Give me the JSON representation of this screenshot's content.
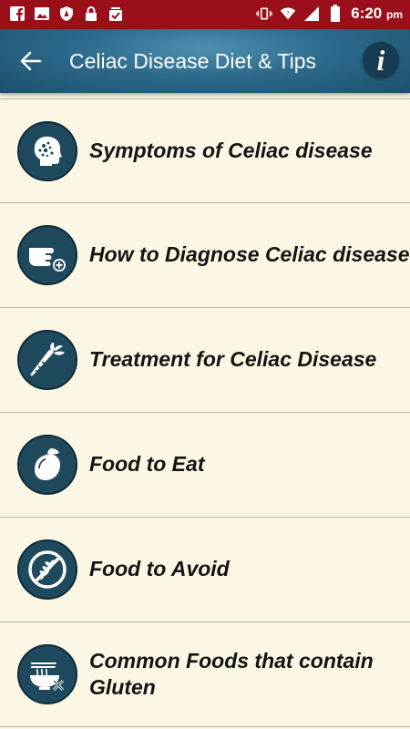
{
  "status_bar": {
    "time": "6:20",
    "ampm": "pm"
  },
  "app_bar": {
    "title": "Celiac Disease Diet & Tips",
    "info_glyph": "i"
  },
  "menu": [
    {
      "label": "Symptoms of Celiac disease",
      "icon": "head-symptoms-icon"
    },
    {
      "label": "How to Diagnose Celiac disease",
      "icon": "diagnose-hand-icon"
    },
    {
      "label": "Treatment for Celiac Disease",
      "icon": "carrot-icon"
    },
    {
      "label": "Food to Eat",
      "icon": "fruit-icon"
    },
    {
      "label": "Food to Avoid",
      "icon": "no-wheat-icon"
    },
    {
      "label": "Common Foods that contain Gluten",
      "icon": "noodle-bowl-icon"
    }
  ],
  "colors": {
    "status_bar": "#9b0f1a",
    "app_bar": "#2c6a8c",
    "icon_circle": "#1f4a5e",
    "background": "#fbf7e4"
  }
}
